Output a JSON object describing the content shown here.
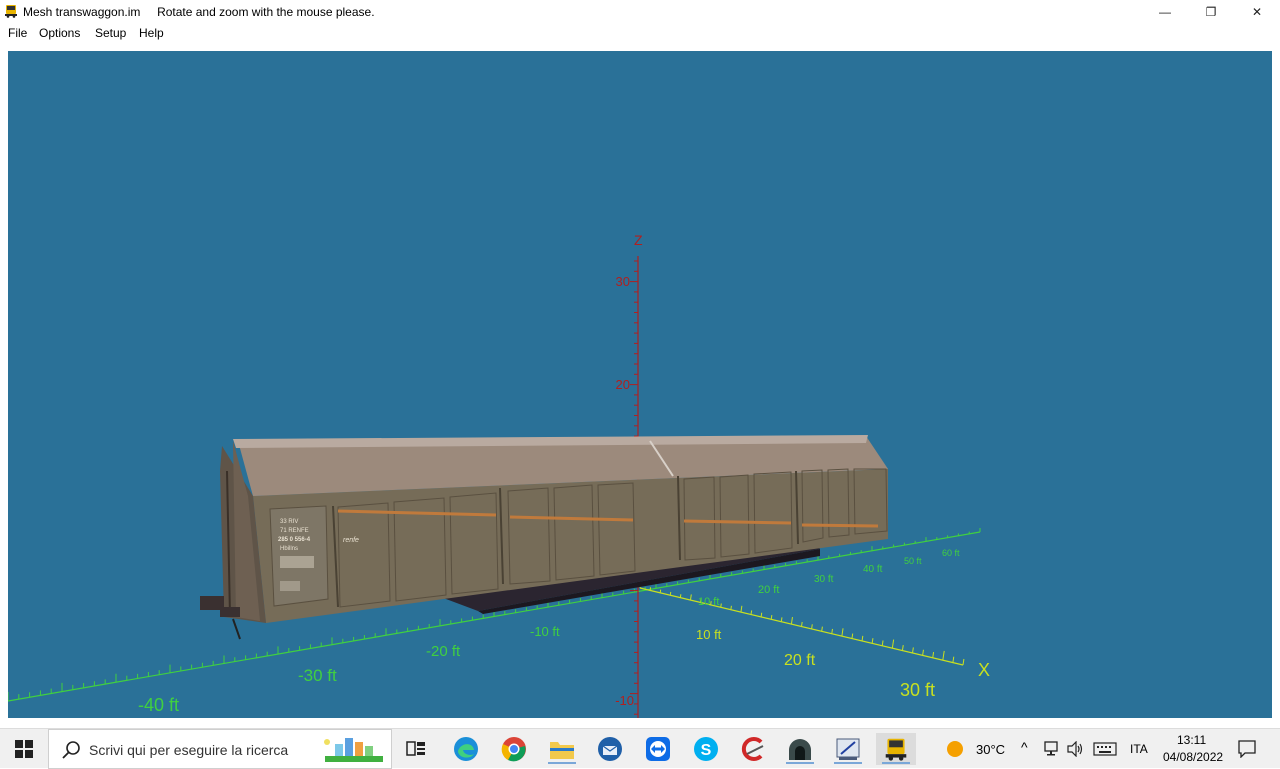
{
  "window": {
    "title": "Mesh transwaggon.im",
    "hint": "Rotate and zoom with the mouse please.",
    "controls": {
      "minimize": "—",
      "restore": "❐",
      "close": "✕"
    }
  },
  "menu": [
    "File",
    "Options",
    "Setup",
    "Help"
  ],
  "scene": {
    "background": "#2a7198",
    "z_axis": {
      "label": "Z",
      "color": "#b02020",
      "ticks": [
        "30",
        "20",
        "-10"
      ]
    },
    "x_axis": {
      "label": "X",
      "color": "#c8e020",
      "ticks": [
        "10 ft",
        "20 ft",
        "30 ft"
      ]
    },
    "y_axis": {
      "color": "#40d040",
      "neg_ticks": [
        "-10 ft",
        "-20 ft",
        "-30 ft",
        "-40 ft"
      ],
      "pos_ticks": [
        "10 ft",
        "20 ft",
        "30 ft",
        "40 ft",
        "50 ft",
        "60 ft"
      ]
    },
    "wagon": {
      "lettering": [
        "33 RIV",
        "71 RENFE",
        "285 0 556-4",
        "Hbillns"
      ],
      "brand": "renfe"
    }
  },
  "taskbar": {
    "search_placeholder": "Scrivi qui per eseguire la ricerca",
    "weather": "30°C",
    "language": "ITA",
    "time": "13:11",
    "date": "04/08/2022"
  }
}
